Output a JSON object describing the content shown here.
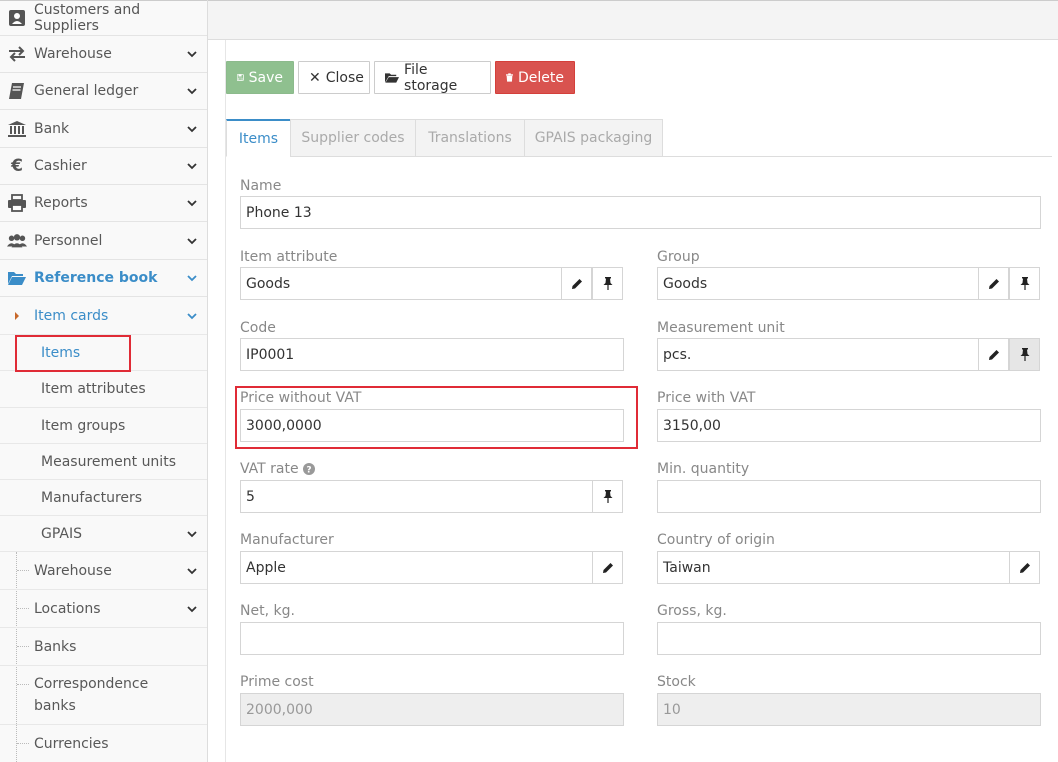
{
  "sidebar": {
    "top_item": "Customers and Suppliers",
    "items": [
      {
        "label": "Warehouse",
        "icon": "exchange-icon"
      },
      {
        "label": "General ledger",
        "icon": "book-icon"
      },
      {
        "label": "Bank",
        "icon": "bank-icon"
      },
      {
        "label": "Cashier",
        "icon": "euro-icon"
      },
      {
        "label": "Reports",
        "icon": "print-icon"
      },
      {
        "label": "Personnel",
        "icon": "users-icon"
      },
      {
        "label": "Reference book",
        "icon": "folder-open-icon"
      }
    ],
    "item_cards": "Item cards",
    "item_cards_children": [
      "Items",
      "Item attributes",
      "Item groups",
      "Measurement units",
      "Manufacturers",
      "GPAIS"
    ],
    "reference_children": [
      "Warehouse",
      "Locations",
      "Banks",
      "Correspondence banks",
      "Currencies"
    ]
  },
  "toolbar": {
    "save": "Save",
    "close": "Close",
    "file_storage": "File storage",
    "delete": "Delete"
  },
  "tabs": [
    "Items",
    "Supplier codes",
    "Translations",
    "GPAIS packaging"
  ],
  "form": {
    "name": {
      "label": "Name",
      "value": "Phone 13"
    },
    "item_attribute": {
      "label": "Item attribute",
      "value": "Goods"
    },
    "group": {
      "label": "Group",
      "value": "Goods"
    },
    "code": {
      "label": "Code",
      "value": "IP0001"
    },
    "measurement_unit": {
      "label": "Measurement unit",
      "value": "pcs."
    },
    "price_without_vat": {
      "label": "Price without VAT",
      "value": "3000,0000"
    },
    "price_with_vat": {
      "label": "Price with VAT",
      "value": "3150,00"
    },
    "vat_rate": {
      "label": "VAT rate",
      "value": "5"
    },
    "min_quantity": {
      "label": "Min. quantity",
      "value": ""
    },
    "manufacturer": {
      "label": "Manufacturer",
      "value": "Apple"
    },
    "country_of_origin": {
      "label": "Country of origin",
      "value": "Taiwan"
    },
    "net_kg": {
      "label": "Net, kg.",
      "value": ""
    },
    "gross_kg": {
      "label": "Gross, kg.",
      "value": ""
    },
    "prime_cost": {
      "label": "Prime cost",
      "value": "2000,000"
    },
    "stock": {
      "label": "Stock",
      "value": "10"
    }
  },
  "colors": {
    "accent": "#3b8dc8",
    "save": "#8fc08f",
    "delete": "#d9534f",
    "highlight": "#e02b36"
  }
}
